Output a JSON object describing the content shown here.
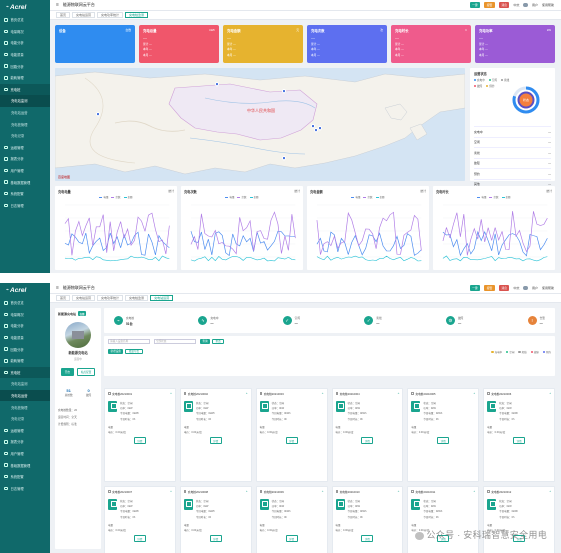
{
  "app": {
    "brand": "Acrel",
    "title": "能源物联网云平台"
  },
  "topbar": {
    "btn_upgrade": "一键",
    "btn_alarm": "报警",
    "btn_msg": "消息",
    "lang": "中文",
    "user": "用户",
    "help": "使用帮助"
  },
  "shot1": {
    "sidebar": [
      {
        "label": "首页总览"
      },
      {
        "label": "电量概况"
      },
      {
        "label": "电能分析"
      },
      {
        "label": "电能质量"
      },
      {
        "label": "回路分析"
      },
      {
        "label": "能耗管理"
      },
      {
        "label": "充电桩",
        "active": true
      },
      {
        "label": "充电站监测",
        "sub": true,
        "current": true
      },
      {
        "label": "充电站运营",
        "sub": true
      },
      {
        "label": "充电桩管理",
        "sub": true
      },
      {
        "label": "充电记录",
        "sub": true
      },
      {
        "label": "运维管理"
      },
      {
        "label": "报表分析"
      },
      {
        "label": "用户管理"
      },
      {
        "label": "基础数据管理"
      },
      {
        "label": "系统配置"
      },
      {
        "label": "日志管理"
      }
    ],
    "tabs": [
      {
        "label": "首页"
      },
      {
        "label": "充电站运营"
      },
      {
        "label": "充电功率统计"
      },
      {
        "label": "充电桩监测",
        "active": true
      }
    ],
    "kpis": [
      {
        "title": "设备",
        "right": "台数",
        "value": "",
        "l1": "",
        "l2": "",
        "l3": "",
        "color": "#2f8cf0"
      },
      {
        "title": "充电总量",
        "right": "kWh",
        "value": "—",
        "l1": "累计 —",
        "l2": "本年 —",
        "l3": "本月 —",
        "color": "#f0566b"
      },
      {
        "title": "充电金额",
        "right": "元",
        "value": "—",
        "l1": "累计 —",
        "l2": "本年 —",
        "l3": "本月 —",
        "color": "#e6b32f"
      },
      {
        "title": "充电次数",
        "right": "次",
        "value": "—",
        "l1": "累计 —",
        "l2": "本年 —",
        "l3": "本月 —",
        "color": "#5d6ff0"
      },
      {
        "title": "充电时长",
        "right": "h",
        "value": "—",
        "l1": "累计 —",
        "l2": "本年 —",
        "l3": "本月 —",
        "color": "#ef5b8c"
      },
      {
        "title": "充电功率",
        "right": "kW",
        "value": "—",
        "l1": "累计 —",
        "l2": "本年 —",
        "l3": "本月 —",
        "color": "#9b5bd6"
      }
    ],
    "map": {
      "country_label": "中华人民共和国",
      "watermark": "百度地图"
    },
    "status": {
      "title": "运营状态",
      "legend": [
        {
          "label": "充电中",
          "color": "#2f8cf0"
        },
        {
          "label": "空闲",
          "color": "#22c08a"
        },
        {
          "label": "离线",
          "color": "#999999"
        },
        {
          "label": "故障",
          "color": "#f0566b"
        },
        {
          "label": "预约",
          "color": "#e6b32f"
        }
      ],
      "center": "状态",
      "rows": [
        {
          "k": "充电中",
          "v": "—"
        },
        {
          "k": "空闲",
          "v": "—"
        },
        {
          "k": "离线",
          "v": "—"
        },
        {
          "k": "故障",
          "v": "—"
        },
        {
          "k": "预约",
          "v": "—"
        },
        {
          "k": "其他",
          "v": "—"
        }
      ]
    },
    "charts": [
      {
        "title": "充电电量",
        "right": "统计",
        "legend": [
          "电量",
          "次数",
          "金额"
        ]
      },
      {
        "title": "充电次数",
        "right": "统计",
        "legend": [
          "电量",
          "次数",
          "金额"
        ]
      },
      {
        "title": "充电金额",
        "right": "统计",
        "legend": [
          "电量",
          "次数",
          "金额"
        ]
      },
      {
        "title": "充电时长",
        "right": "统计",
        "legend": [
          "电量",
          "次数",
          "金额"
        ]
      }
    ]
  },
  "shot2": {
    "tabs": [
      {
        "label": "首页"
      },
      {
        "label": "充电站运营"
      },
      {
        "label": "充电功率统计"
      },
      {
        "label": "充电桩监测"
      },
      {
        "label": "充电站运营",
        "active": true
      }
    ],
    "left": {
      "title": "新能源充电站",
      "badge": "在线",
      "station_name": "新能源充电站",
      "station_sub": "运营中",
      "btn_a": "开启",
      "btn_b": "站点配置",
      "n1": "51",
      "n1_label": "总桩数",
      "n2": "0",
      "n2_label": "故障",
      "info": [
        "充电桩数量：20",
        "运营时间：全天",
        "计费规则：标准"
      ]
    },
    "status_row": [
      {
        "label": "充电桩",
        "value": "51台",
        "icon": "plug-icon"
      },
      {
        "label": "充电中",
        "value": "—",
        "icon": "bolt-icon"
      },
      {
        "label": "空闲",
        "value": "—",
        "icon": "check-icon"
      },
      {
        "label": "离线",
        "value": "—",
        "icon": "check-icon"
      },
      {
        "label": "故障",
        "value": "—",
        "icon": "wrench-icon"
      },
      {
        "label": "告警",
        "value": "—",
        "icon": "warning-icon"
      }
    ],
    "search_placeholder": "请输入设备名称",
    "search_value": "全部状态",
    "btn_query": "查询",
    "btn_reset": "重置",
    "btn_add": "新增设备",
    "btn_export": "批量导出",
    "legend": [
      {
        "label": "充电中",
        "color": "#e6b32f"
      },
      {
        "label": "空闲",
        "color": "#22c08a"
      },
      {
        "label": "离线",
        "color": "#999999"
      },
      {
        "label": "故障",
        "color": "#f0566b"
      },
      {
        "label": "预约",
        "color": "#5d6ff0"
      }
    ],
    "card_template": {
      "l1": "状态：空闲",
      "l2": "功率：0kW",
      "l3": "今日电量：0kWh",
      "l4": "今日时长：0h",
      "cap": "电量",
      "bottom": "电价：0.00元/度",
      "btn": "详情"
    },
    "card_codes": [
      "充电桩20210001",
      "充电桩20210002",
      "充电桩20210003",
      "充电桩20210004",
      "充电桩20210005",
      "充电桩20210006",
      "充电桩20210007",
      "充电桩20210008",
      "充电桩20210009",
      "充电桩20210010",
      "充电桩20210011",
      "充电桩20210012"
    ]
  },
  "watermark": {
    "text": "公众号 · 安科瑞智慧安全用电"
  }
}
